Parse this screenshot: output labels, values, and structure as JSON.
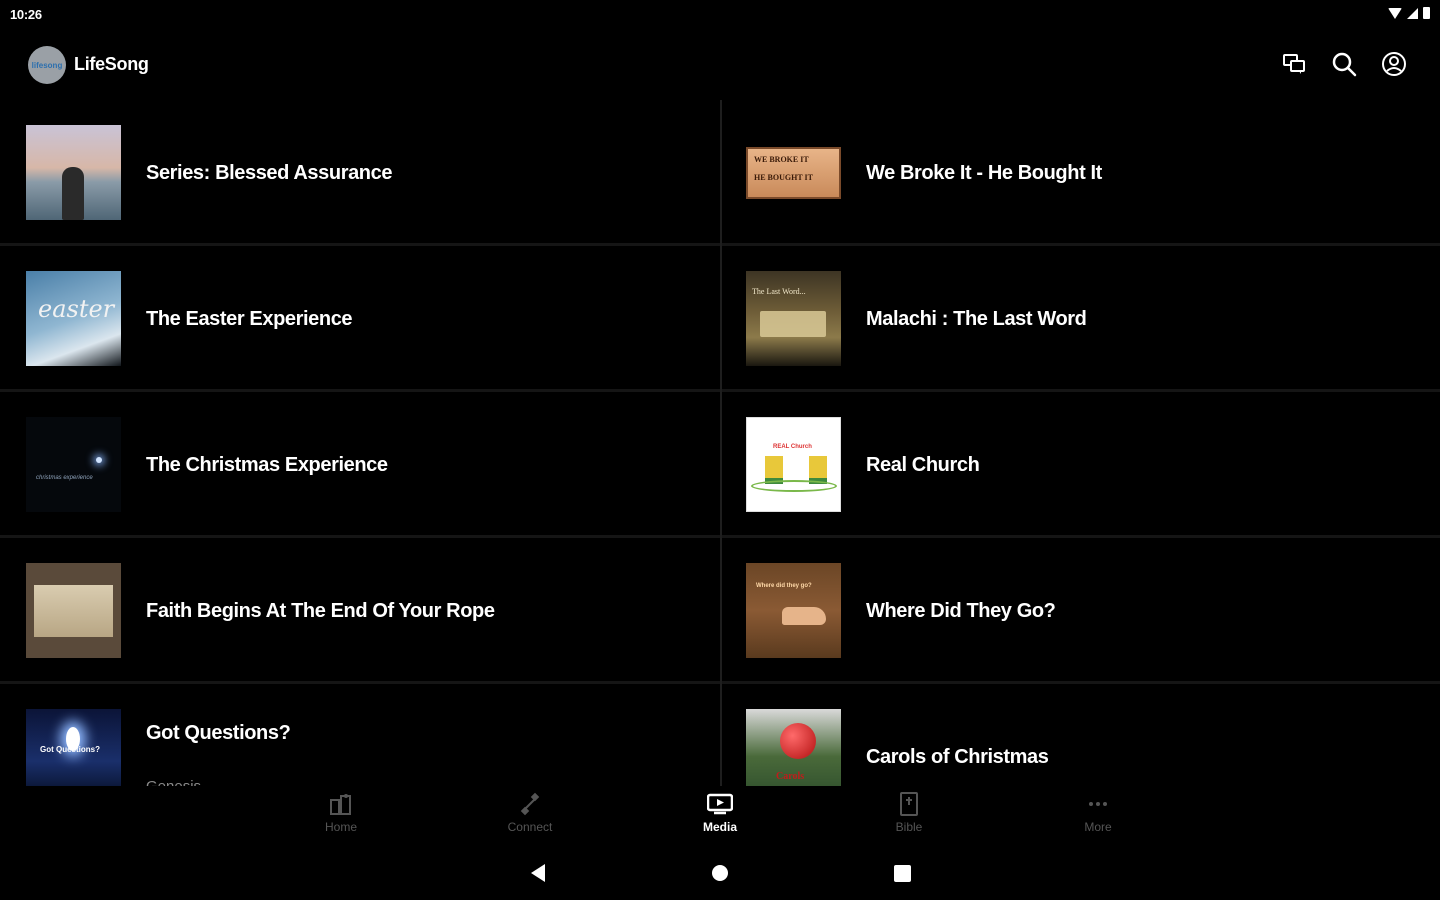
{
  "status_bar": {
    "time": "10:26"
  },
  "app_bar": {
    "title": "LifeSong",
    "logo_text": "lifesong"
  },
  "media_list": {
    "left": [
      {
        "title": "Series: Blessed Assurance",
        "subtitle": ""
      },
      {
        "title": "The Easter Experience",
        "subtitle": "",
        "thumb_text": "easter"
      },
      {
        "title": "The Christmas Experience",
        "subtitle": "",
        "thumb_text": "christmas experience"
      },
      {
        "title": "Faith Begins At The End Of Your Rope",
        "subtitle": ""
      },
      {
        "title": "Got Questions?",
        "subtitle": "Genesis",
        "thumb_text": "Got Questions?"
      }
    ],
    "right": [
      {
        "title": "We Broke It - He Bought It",
        "subtitle": "",
        "thumb_line1": "WE BROKE IT",
        "thumb_line2": "HE BOUGHT IT"
      },
      {
        "title": "Malachi : The Last Word",
        "subtitle": "",
        "thumb_text": "The Last Word..."
      },
      {
        "title": "Real Church",
        "subtitle": "",
        "thumb_text": "REAL Church"
      },
      {
        "title": "Where Did They Go?",
        "subtitle": "",
        "thumb_text": "Where did they go?"
      },
      {
        "title": "Carols of Christmas",
        "subtitle": "",
        "thumb_text": "Carols"
      }
    ]
  },
  "bottom_nav": {
    "items": [
      {
        "label": "Home",
        "icon": "home-icon"
      },
      {
        "label": "Connect",
        "icon": "connect-icon"
      },
      {
        "label": "Media",
        "icon": "media-icon",
        "active": true
      },
      {
        "label": "Bible",
        "icon": "bible-icon"
      },
      {
        "label": "More",
        "icon": "more-icon"
      }
    ]
  }
}
